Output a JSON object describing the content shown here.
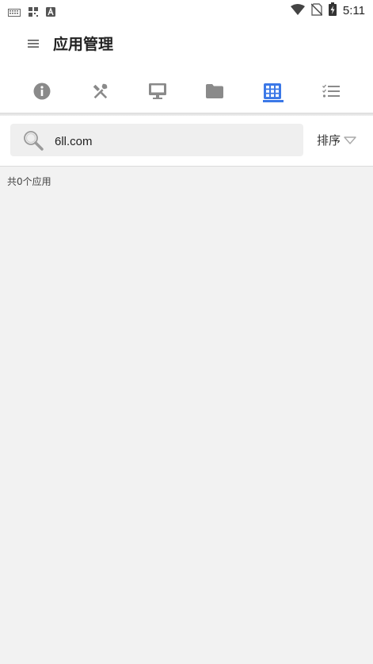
{
  "status_bar": {
    "time": "5:11",
    "left_icons": [
      "keyboard-icon",
      "qr-code-icon",
      "font-a-icon"
    ],
    "right_icons": [
      "wifi-icon",
      "no-sim-icon",
      "battery-charging-icon"
    ]
  },
  "app_bar": {
    "menu_icon": "hamburger-menu-icon",
    "title": "应用管理"
  },
  "tabs": [
    {
      "icon": "info-icon",
      "active": false
    },
    {
      "icon": "tools-icon",
      "active": false
    },
    {
      "icon": "monitor-icon",
      "active": false
    },
    {
      "icon": "folder-icon",
      "active": false
    },
    {
      "icon": "apps-grid-icon",
      "active": true
    },
    {
      "icon": "checklist-icon",
      "active": false
    }
  ],
  "search": {
    "value": "6ll.com",
    "placeholder": ""
  },
  "sort": {
    "label": "排序"
  },
  "list": {
    "count_label": "共0个应用"
  },
  "colors": {
    "accent": "#3b78e7",
    "icon_gray": "#8a8a8a",
    "background": "#f2f2f2"
  }
}
